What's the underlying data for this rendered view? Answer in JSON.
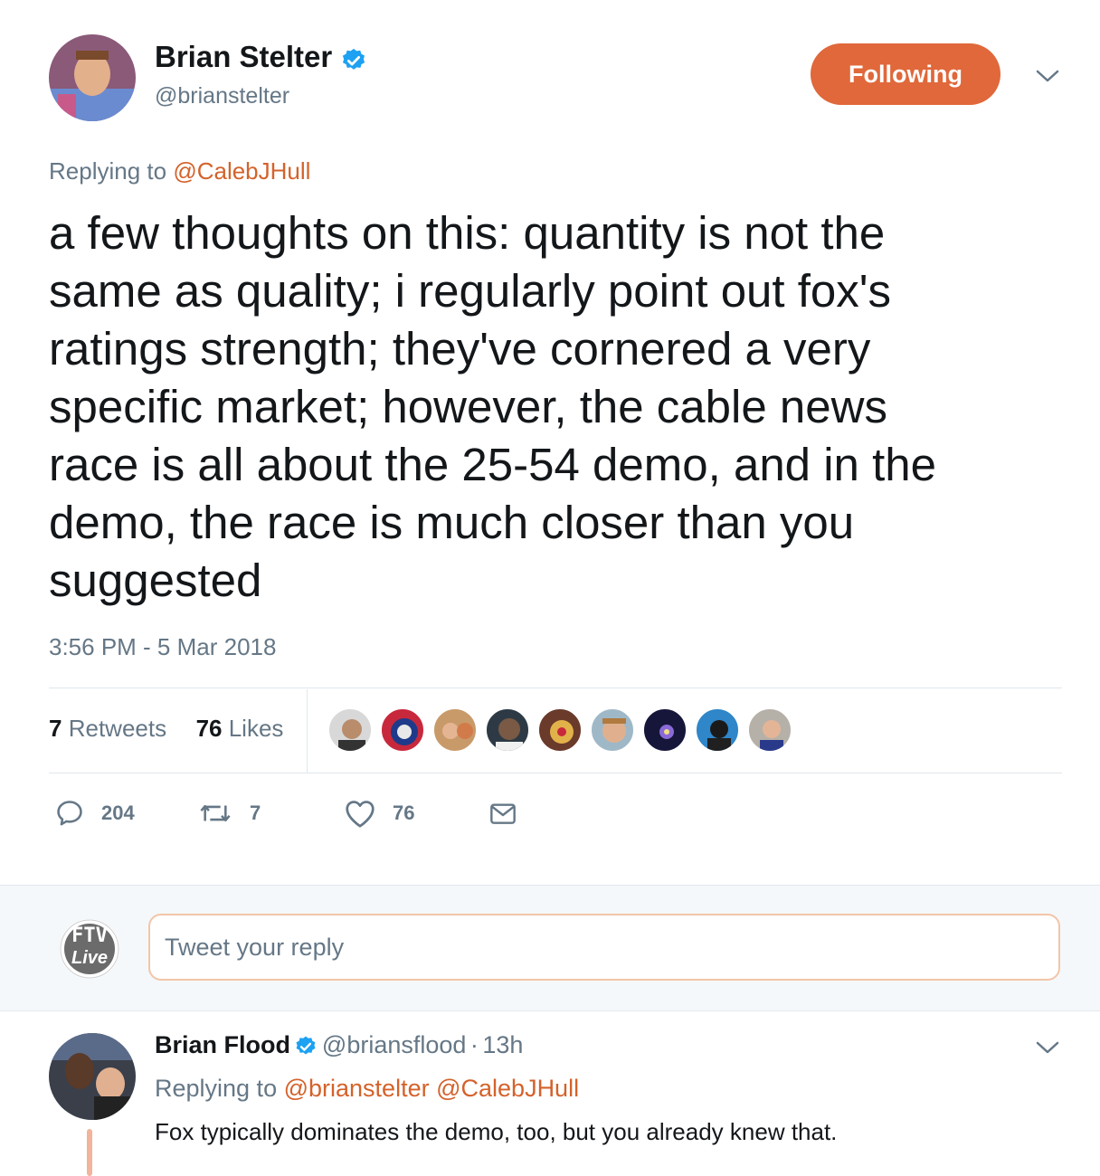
{
  "tweet": {
    "author_name": "Brian Stelter",
    "author_handle": "@brianstelter",
    "follow_label": "Following",
    "replying_prefix": "Replying to",
    "replying_handle": "@CalebJHull",
    "text_lines": [
      "a few thoughts on this: quantity is not the",
      "same as quality; i regularly point out fox's",
      "ratings strength; they've cornered a very",
      "specific market; however, the cable news",
      "race is all about the 25-54 demo, and in the",
      "demo, the race is much closer than you",
      "suggested"
    ],
    "timestamp": "3:56 PM - 5 Mar 2018",
    "retweets_count": "7",
    "retweets_label": "Retweets",
    "likes_count": "76",
    "likes_label": "Likes",
    "actions": {
      "replies": "204",
      "retweets": "7",
      "likes": "76"
    }
  },
  "reply_box": {
    "placeholder": "Tweet your reply",
    "avatar_text_top": "FTV",
    "avatar_text_bottom": "Live"
  },
  "reply": {
    "author_name": "Brian Flood",
    "author_handle": "@briansflood",
    "separator": "·",
    "age": "13h",
    "replying_prefix": "Replying to",
    "replying_handles": [
      "@brianstelter",
      "@CalebJHull"
    ],
    "text": "Fox typically dominates the demo, too, but you already knew that."
  },
  "colors": {
    "accent": "#e0683a",
    "link": "#d4622b",
    "secondary_text": "#657786",
    "verified": "#1da1f2"
  }
}
